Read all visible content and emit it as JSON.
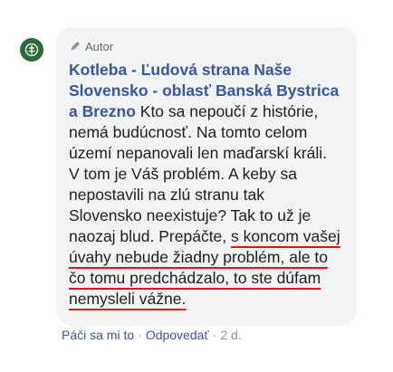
{
  "comment": {
    "author_badge": "Autor",
    "author_name": "Kotleba - Ľudová strana Naše Slovensko - oblasť Banská Bystrica a Brezno",
    "text_plain": " Kto sa nepoučí z histórie, nemá budúcnosť. Na tomto celom území nepanovali len maďarskí králi. V tom je Váš problém. A keby sa nepostavili na zlú stranu tak Slovensko neexistuje? Tak to už je naozaj blud. Prepáčte, ",
    "text_highlighted": "s koncom vašej úvahy nebude žiadny problém, ale to čo tomu predchádzalo, to ste dúfam nemysleli vážne.",
    "avatar_icon": "party-logo-icon",
    "badge_icon": "pencil-icon",
    "highlight_color": "#d7141a",
    "link_color": "#385898"
  },
  "actions": {
    "like": "Páči sa mi to",
    "separator": "·",
    "reply": "Odpovedať",
    "time": "2 d."
  }
}
